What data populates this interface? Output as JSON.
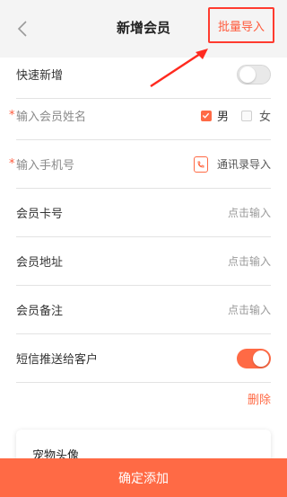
{
  "header": {
    "title": "新增会员",
    "batch_import_label": "批量导入"
  },
  "form": {
    "quick_add_label": "快速新增",
    "quick_add_on": false,
    "name_placeholder": "输入会员姓名",
    "gender_male": "男",
    "gender_female": "女",
    "gender_selected": "男",
    "phone_placeholder": "输入手机号",
    "contacts_import_label": "通讯录导入",
    "card_label": "会员卡号",
    "card_placeholder": "点击输入",
    "address_label": "会员地址",
    "address_placeholder": "点击输入",
    "note_label": "会员备注",
    "note_placeholder": "点击输入",
    "sms_label": "短信推送给客户",
    "sms_on": true,
    "required_mark": "*"
  },
  "delete_label": "删除",
  "pet": {
    "avatar_label": "宠物头像"
  },
  "footer": {
    "confirm_label": "确定添加"
  },
  "colors": {
    "accent": "#ff6a45",
    "highlight": "#ff3b2f"
  }
}
